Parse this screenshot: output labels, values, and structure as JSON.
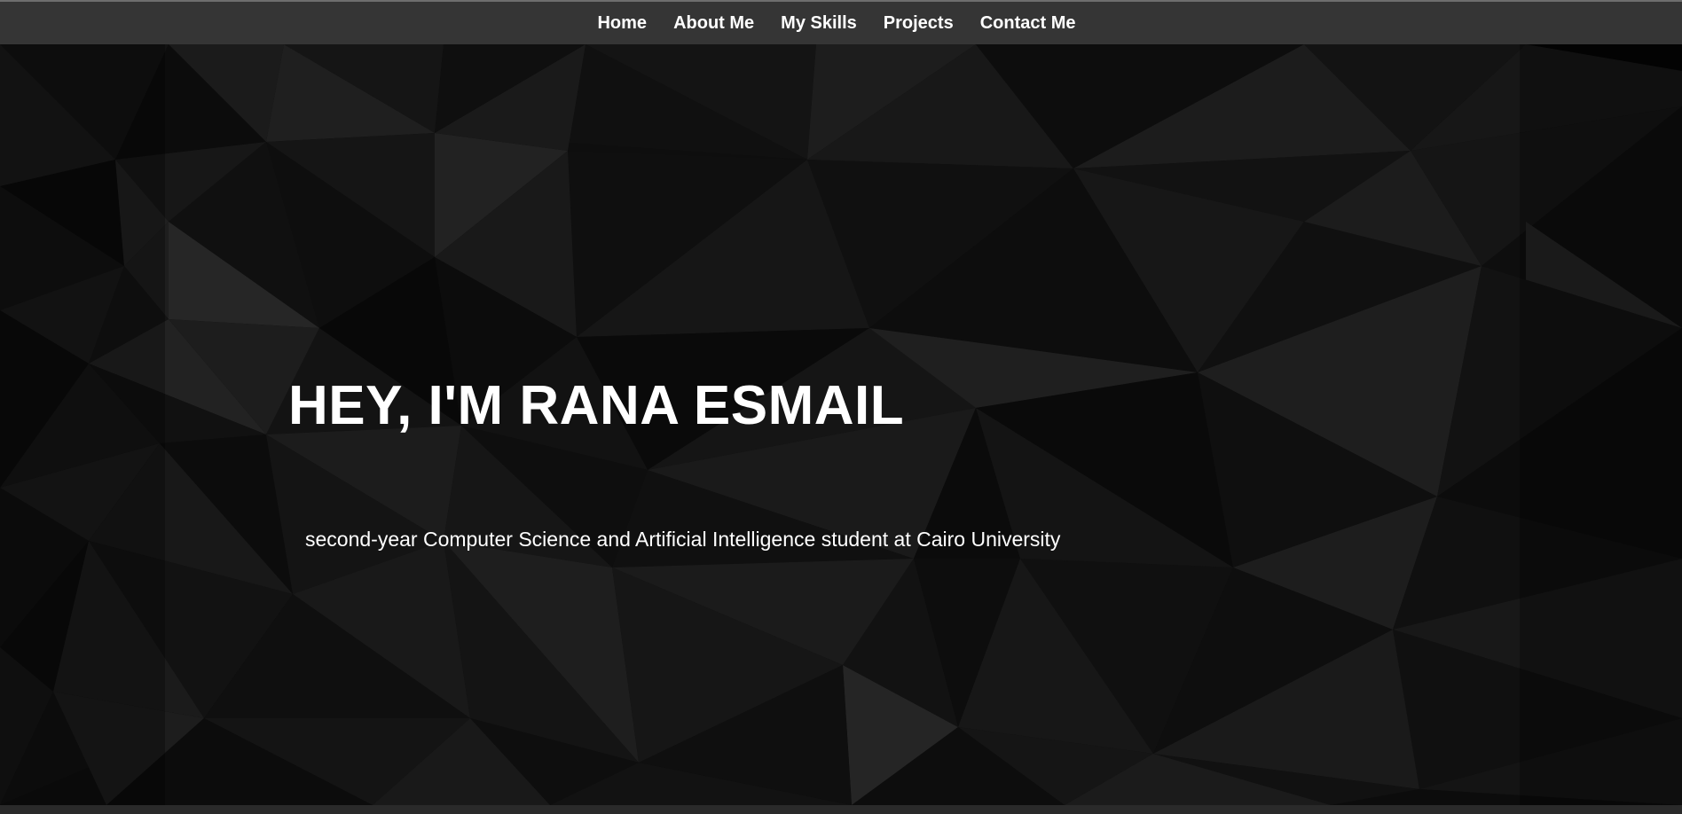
{
  "nav": {
    "items": [
      {
        "label": "Home"
      },
      {
        "label": "About Me"
      },
      {
        "label": "My Skills"
      },
      {
        "label": "Projects"
      },
      {
        "label": "Contact Me"
      }
    ]
  },
  "hero": {
    "title": "HEY, I'M RANA ESMAIL",
    "subtitle": "second-year Computer Science and Artificial Intelligence student at Cairo University"
  },
  "colors": {
    "navbar": "#353535",
    "background": "#0e0e0e",
    "text": "#ffffff"
  }
}
